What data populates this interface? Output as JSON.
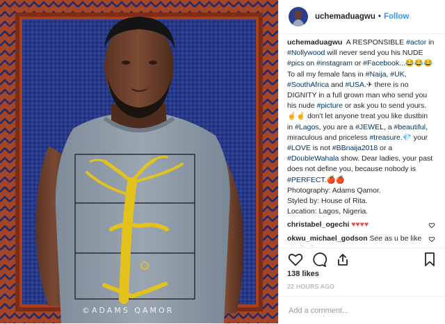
{
  "post": {
    "username": "uchemaduagwu",
    "separator": "•",
    "follow_label": "Follow",
    "photo_watermark": "©ADAMS QAMOR",
    "caption": {
      "username": "uchemaduagwu",
      "segments": [
        {
          "t": "text",
          "v": "A RESPONSIBLE "
        },
        {
          "t": "tag",
          "v": "#actor"
        },
        {
          "t": "text",
          "v": " in "
        },
        {
          "t": "tag",
          "v": "#Nollywood"
        },
        {
          "t": "text",
          "v": " will never send you his NUDE "
        },
        {
          "t": "tag",
          "v": "#pics"
        },
        {
          "t": "text",
          "v": " on "
        },
        {
          "t": "tag",
          "v": "#instagram"
        },
        {
          "t": "text",
          "v": " or "
        },
        {
          "t": "tag",
          "v": "#Facebook"
        },
        {
          "t": "text",
          "v": "...😂😂😂\nTo all my female fans in "
        },
        {
          "t": "tag",
          "v": "#Naija"
        },
        {
          "t": "text",
          "v": ", "
        },
        {
          "t": "tag",
          "v": "#UK"
        },
        {
          "t": "text",
          "v": ", "
        },
        {
          "t": "tag",
          "v": "#SouthAfrica"
        },
        {
          "t": "text",
          "v": " and "
        },
        {
          "t": "tag",
          "v": "#USA"
        },
        {
          "t": "text",
          "v": ".✈ there is no DIGNITY in a full grown man who send you his nude "
        },
        {
          "t": "tag",
          "v": "#picture"
        },
        {
          "t": "text",
          "v": " or ask you to send yours. ☝☝ don't let anyone treat you like dustbin in "
        },
        {
          "t": "tag",
          "v": "#Lagos"
        },
        {
          "t": "text",
          "v": ", you are a "
        },
        {
          "t": "tag",
          "v": "#JEWEL"
        },
        {
          "t": "text",
          "v": ", a "
        },
        {
          "t": "tag",
          "v": "#beautiful"
        },
        {
          "t": "text",
          "v": ", miraculous and priceless "
        },
        {
          "t": "tag",
          "v": "#treasure"
        },
        {
          "t": "text",
          "v": ".💎 your "
        },
        {
          "t": "tag",
          "v": "#LOVE"
        },
        {
          "t": "text",
          "v": " is not "
        },
        {
          "t": "tag",
          "v": "#BBnaija2018"
        },
        {
          "t": "text",
          "v": " or a "
        },
        {
          "t": "tag",
          "v": "#DoubleWahala"
        },
        {
          "t": "text",
          "v": " show. Dear ladies, your past does not define you, because nobody is "
        },
        {
          "t": "tag",
          "v": "#PERFECT"
        },
        {
          "t": "text",
          "v": ".🍎🍎\nPhotography: Adams Qamor.\nStyled by: House of Rita.\nLocation: Lagos, Nigeria."
        }
      ]
    },
    "comments": [
      {
        "username": "christabel_ogechi",
        "text": "♥♥♥♥"
      },
      {
        "username": "okwu_michael_godson",
        "text": "See as u be like ekwikwii"
      }
    ],
    "likes": "138 likes",
    "time": "22 HOURS AGO",
    "add_comment_placeholder": "Add a comment...",
    "colors": {
      "accent": "#3897f0",
      "hashtag": "#003569",
      "heart": "#ed4956",
      "muted": "#999999"
    },
    "icons": [
      "heart-icon",
      "comment-icon",
      "share-icon",
      "bookmark-icon",
      "heart-outline-icon"
    ]
  }
}
